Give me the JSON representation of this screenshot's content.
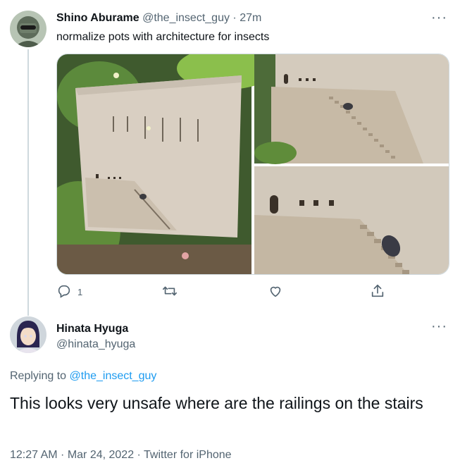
{
  "tweet1": {
    "display_name": "Shino Aburame",
    "handle": "@the_insect_guy",
    "separator": "·",
    "time": "27m",
    "text": "normalize pots with architecture for insects",
    "more_icon": "more-horizontal-icon",
    "actions": {
      "reply_count": "1",
      "reply_icon": "reply-icon",
      "retweet_icon": "retweet-icon",
      "like_icon": "heart-icon",
      "share_icon": "share-icon"
    },
    "media": [
      {
        "name": "photo-pot-full"
      },
      {
        "name": "photo-pot-stairs-top"
      },
      {
        "name": "photo-pot-stairs-closeup"
      }
    ]
  },
  "tweet2": {
    "display_name": "Hinata Hyuga",
    "handle": "@hinata_hyuga",
    "replying_prefix": "Replying to ",
    "replying_to": "@the_insect_guy",
    "text": "This looks very unsafe where are the railings on the stairs",
    "timestamp": "12:27 AM · Mar 24, 2022 · Twitter for iPhone",
    "more_icon": "more-horizontal-icon"
  },
  "colors": {
    "text_primary": "#0f1419",
    "text_secondary": "#536471",
    "link": "#1d9bf0",
    "thread_line": "#cfd9de"
  }
}
